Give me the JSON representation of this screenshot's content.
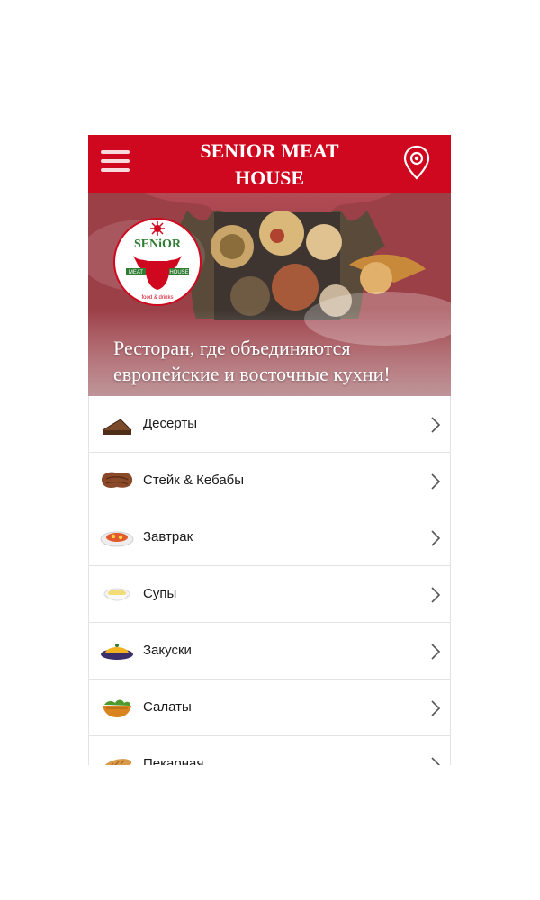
{
  "header": {
    "title": "SENIOR MEAT HOUSE",
    "brand_color": "#d0081f"
  },
  "hero": {
    "tagline": "Ресторан, где объединяются европейские и восточные кухни!",
    "logo_text": "SENiOR MEAT HOUSE food & drinks"
  },
  "menu": {
    "items": [
      {
        "label": "Десерты",
        "icon": "cake-icon"
      },
      {
        "label": "Стейк & Кебабы",
        "icon": "steak-icon"
      },
      {
        "label": "Завтрак",
        "icon": "breakfast-plate-icon"
      },
      {
        "label": "Супы",
        "icon": "soup-bowl-icon"
      },
      {
        "label": "Закуски",
        "icon": "snacks-plate-icon"
      },
      {
        "label": "Салаты",
        "icon": "salad-bowl-icon"
      },
      {
        "label": "Пекарная",
        "icon": "bread-icon"
      }
    ]
  }
}
